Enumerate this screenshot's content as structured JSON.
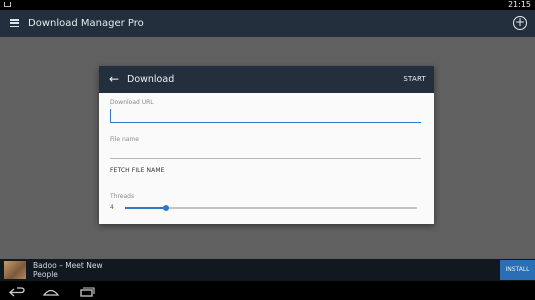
{
  "status_bar": {
    "time": "21:15"
  },
  "app_bar": {
    "title": "Download Manager Pro",
    "menu_icon": "hamburger-icon",
    "add_icon": "add-circle-icon"
  },
  "dialog": {
    "title": "Download",
    "back_icon": "arrow-back-icon",
    "start_label": "START",
    "url_label": "Download URL",
    "url_value": "",
    "file_name_label": "File name",
    "file_name_value": "",
    "fetch_label": "FETCH FILE NAME",
    "threads_label": "Threads",
    "threads_value": "4",
    "threads_slider_fraction": 0.14
  },
  "ad": {
    "text": "Badoo – Meet New People",
    "install_label": "INSTALL"
  },
  "nav_bar": {
    "back_icon": "nav-back-icon",
    "home_icon": "nav-home-icon",
    "recents_icon": "nav-recents-icon"
  },
  "colors": {
    "app_bar": "#232f3d",
    "accent": "#2d79c7",
    "overlay": "#606060",
    "dialog_bg": "#fafafa"
  }
}
